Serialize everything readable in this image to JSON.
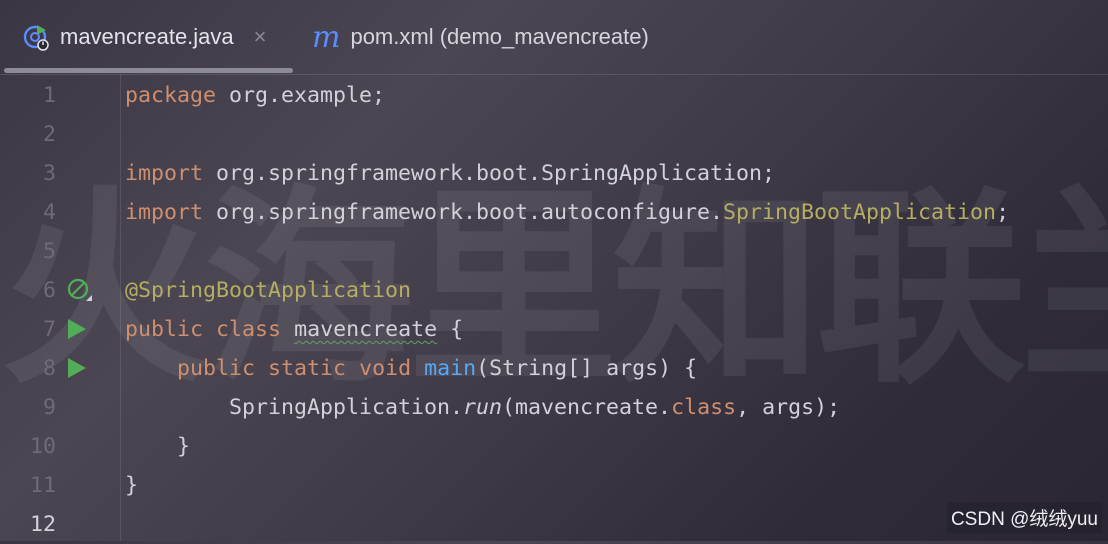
{
  "watermark": {
    "text": "火海里知联兰开"
  },
  "tabs": [
    {
      "label": "mavencreate.java",
      "icon": "java-class-run-icon",
      "active": true,
      "close": "×"
    },
    {
      "label": "pom.xml (demo_mavencreate)",
      "icon": "maven-icon",
      "active": false,
      "icon_glyph": "m"
    }
  ],
  "code": {
    "line_numbers": [
      "1",
      "2",
      "3",
      "4",
      "5",
      "6",
      "7",
      "8",
      "9",
      "10",
      "11",
      "12"
    ],
    "lines": {
      "l1": {
        "kw": "package",
        "rest": " org.example;"
      },
      "l3": {
        "kw": "import",
        "rest": " org.springframework.boot.SpringApplication;"
      },
      "l4": {
        "kw": "import",
        "rest": " org.springframework.boot.autoconfigure.",
        "ann": "SpringBootApplication",
        "tail": ";"
      },
      "l6": {
        "ann": "@SpringBootApplication"
      },
      "l7": {
        "kw1": "public",
        "kw2": "class",
        "name": "mavencreate",
        "tail": " {"
      },
      "l8": {
        "kw1": "public",
        "kw2": "static",
        "kw3": "void",
        "fn": "main",
        "rest": "(String[] args) {"
      },
      "l9": {
        "a": "SpringApplication.",
        "it": "run",
        "b": "(mavencreate.",
        "kw": "class",
        "c": ", args);"
      },
      "l10": {
        "text": "}"
      },
      "l11": {
        "text": "}"
      }
    }
  },
  "colors": {
    "keyword": "#cf8e6d",
    "annotation": "#b3ae60",
    "method": "#56a8f5",
    "text": "#d2d0d9",
    "run": "#4fae57"
  },
  "watermark_badge": "CSDN @绒绒yuu"
}
